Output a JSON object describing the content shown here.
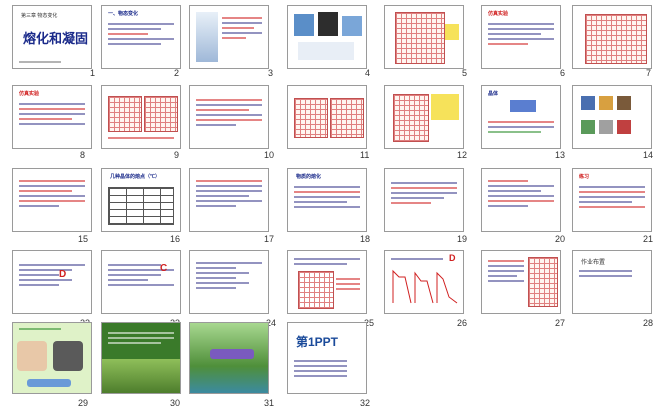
{
  "slide_sorter": {
    "slides": [
      {
        "number": "1",
        "title": "熔化和凝固",
        "subtitle": "第三章 物态变化"
      },
      {
        "number": "2",
        "title": "一、物态变化"
      },
      {
        "number": "3"
      },
      {
        "number": "4"
      },
      {
        "number": "5"
      },
      {
        "number": "6",
        "title": "仿真实验"
      },
      {
        "number": "7"
      },
      {
        "number": "8",
        "title": "仿真实验"
      },
      {
        "number": "9"
      },
      {
        "number": "10"
      },
      {
        "number": "11"
      },
      {
        "number": "12"
      },
      {
        "number": "13",
        "title": "晶体"
      },
      {
        "number": "14"
      },
      {
        "number": "15"
      },
      {
        "number": "16",
        "title": "几种晶体的熔点（℃）"
      },
      {
        "number": "17"
      },
      {
        "number": "18",
        "title": "物质的熔化"
      },
      {
        "number": "19"
      },
      {
        "number": "20"
      },
      {
        "number": "21",
        "title": "练习"
      },
      {
        "number": "22",
        "answer": "D"
      },
      {
        "number": "23",
        "answer": "C"
      },
      {
        "number": "24"
      },
      {
        "number": "25"
      },
      {
        "number": "26",
        "answer": "D"
      },
      {
        "number": "27"
      },
      {
        "number": "28",
        "title": "作业布置"
      },
      {
        "number": "29"
      },
      {
        "number": "30"
      },
      {
        "number": "31"
      },
      {
        "number": "32",
        "title": "第1PPT"
      }
    ]
  },
  "colors": {
    "frame_border": "#9a9a9a",
    "grid_red": "#e08080",
    "title_blue": "#1a2a8a",
    "accent_red": "#d02020",
    "photo_green": "#4f8f3a"
  }
}
